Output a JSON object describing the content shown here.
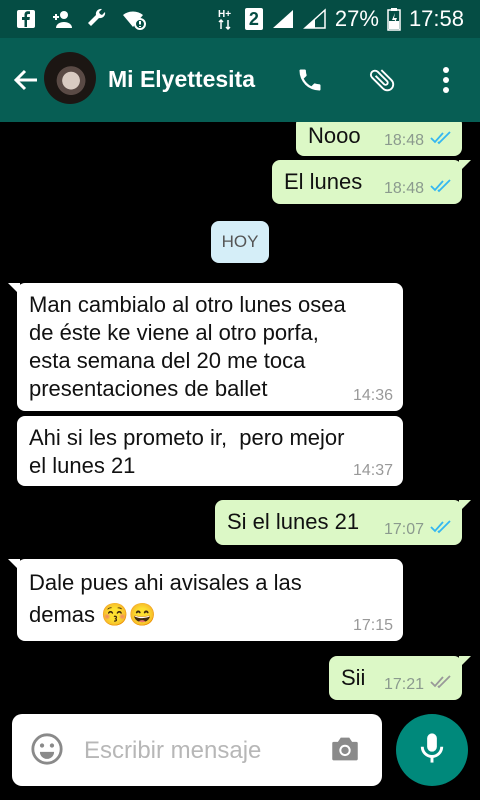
{
  "status_bar": {
    "battery": "27%",
    "time": "17:58",
    "sim_badge": "2"
  },
  "header": {
    "contact_name": "Mi Elyettesita"
  },
  "day_label": "HOY",
  "messages": [
    {
      "dir": "out",
      "text": "Nooo",
      "time": "18:48",
      "ticks": "read"
    },
    {
      "dir": "out",
      "text": "El lunes",
      "time": "18:48",
      "ticks": "read"
    },
    {
      "dir": "in",
      "text": "Man cambialo al otro lunes osea\nde éste ke viene al otro porfa,\nesta semana del 20 me toca\npresentaciones de ballet",
      "time": "14:36"
    },
    {
      "dir": "in",
      "text": "Ahi si les prometo ir,  pero mejor\nel lunes 21",
      "time": "14:37"
    },
    {
      "dir": "out",
      "text": "Si el lunes 21",
      "time": "17:07",
      "ticks": "read"
    },
    {
      "dir": "in",
      "text": "Dale pues ahi avisales a las\ndemas 😚😄",
      "time": "17:15"
    },
    {
      "dir": "out",
      "text": "Sii",
      "time": "17:21",
      "ticks": "delivered"
    }
  ],
  "composer": {
    "placeholder": "Escribir mensaje"
  },
  "colors": {
    "header": "#075e54",
    "status_bar": "#054d44",
    "outgoing_bubble": "#dcf8c6",
    "incoming_bubble": "#ffffff",
    "read_ticks": "#34b7f1",
    "delivered_ticks": "#999999",
    "mic_button": "#00897b"
  },
  "icons": [
    "back-arrow-icon",
    "phone-icon",
    "paperclip-icon",
    "more-vert-icon",
    "emoji-icon",
    "camera-icon",
    "mic-icon"
  ]
}
